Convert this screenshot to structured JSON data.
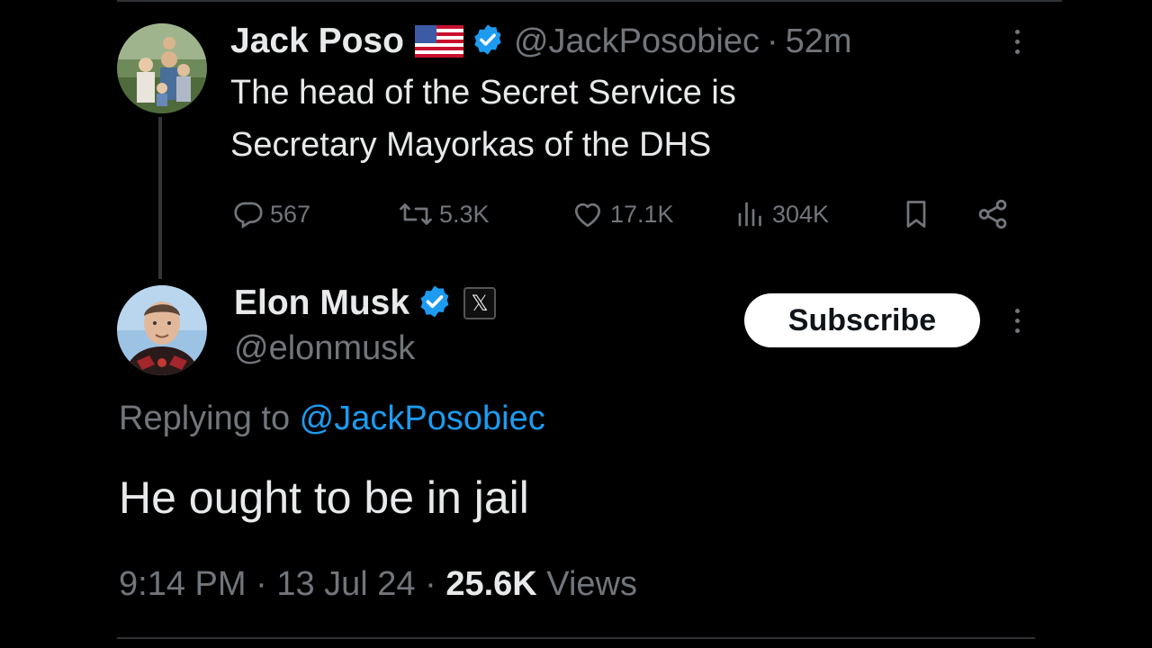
{
  "parent_tweet": {
    "author_name": "Jack Poso",
    "author_flag": "us-flag-icon",
    "author_handle": "@JackPosobiec",
    "separator": "·",
    "time_ago": "52m",
    "text_line1": "The head of the Secret Service is",
    "text_line2": "Secretary Mayorkas of the DHS",
    "stats": {
      "replies": "567",
      "reposts": "5.3K",
      "likes": "17.1K",
      "views": "304K"
    }
  },
  "main_tweet": {
    "author_name": "Elon Musk",
    "author_handle": "@elonmusk",
    "affiliate_badge": "𝕏",
    "subscribe_label": "Subscribe",
    "replying_prefix": "Replying to ",
    "replying_to": "@JackPosobiec",
    "text": "He ought to be in jail",
    "timestamp": "9:14 PM",
    "date": "13 Jul 24",
    "separator": "·",
    "views_count": "25.6K",
    "views_label": "Views"
  },
  "colors": {
    "background": "#000000",
    "text_primary": "#e7e9ea",
    "text_secondary": "#71767b",
    "link": "#1d9bf0",
    "verified": "#1d9bf0",
    "subscribe_bg": "#ffffff"
  }
}
